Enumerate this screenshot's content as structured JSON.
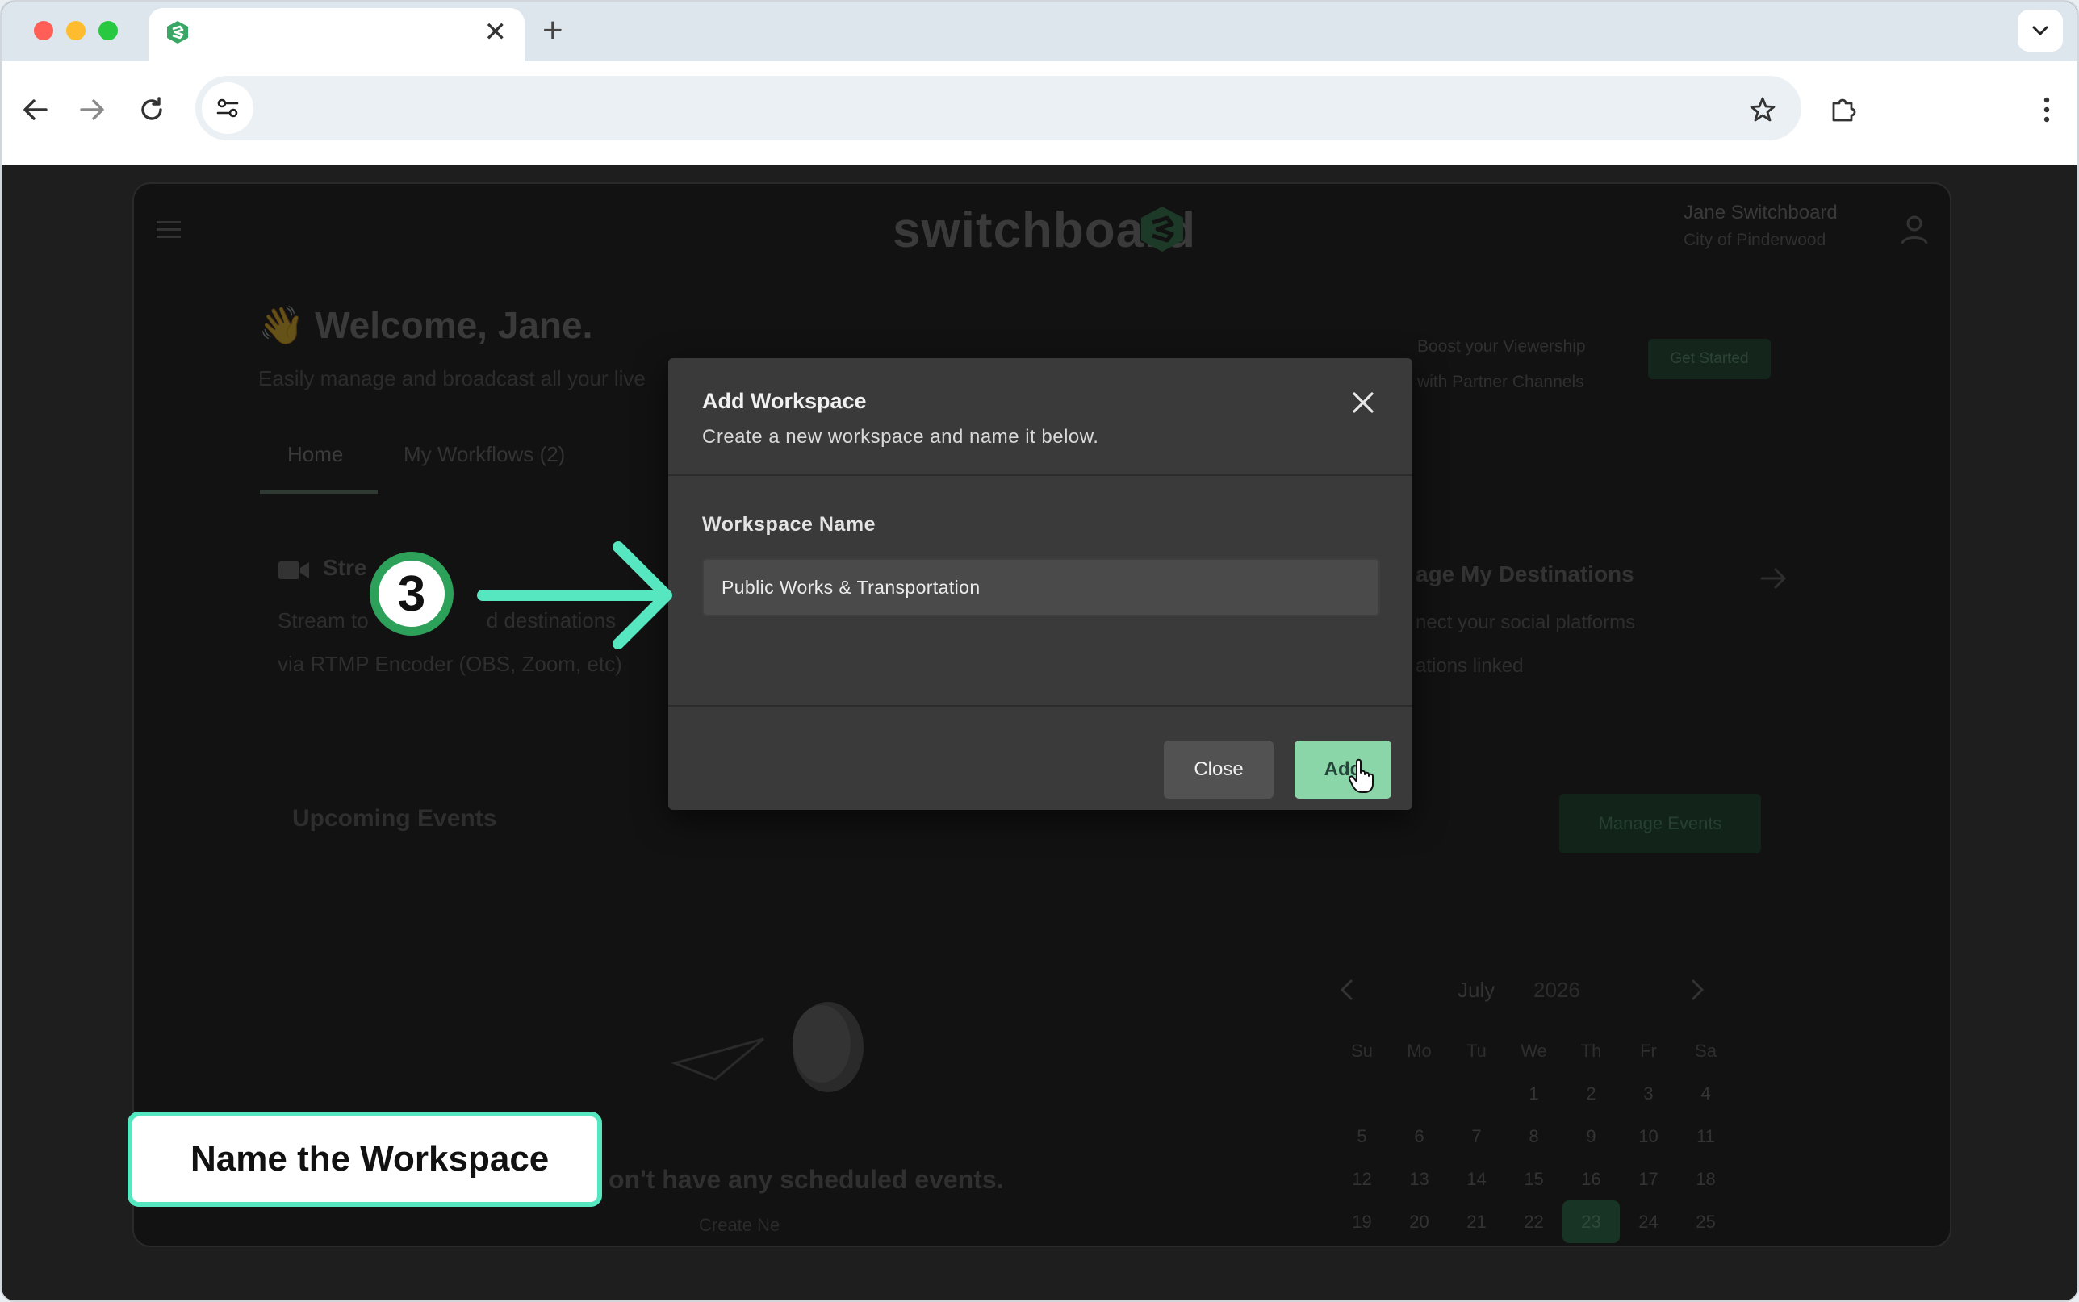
{
  "browser": {
    "tab_close_glyph": "✕",
    "new_tab_glyph": "+"
  },
  "app": {
    "logo_text": "switchboard",
    "user_name": "Jane Switchboard",
    "user_role": "City of Pinderwood",
    "welcome": "Welcome, Jane.",
    "welcome_emoji": "👋",
    "subtitle": "Easily manage and broadcast all your live",
    "tabs": [
      {
        "label": "Home"
      },
      {
        "label": "My Workflows (2)"
      }
    ],
    "boost_line1": "Boost your Viewership",
    "boost_line2": "with Partner Channels",
    "get_started": "Get Started",
    "stream_card": {
      "title": "Stre",
      "line1": "Stream to",
      "line1_tail": "d destinations",
      "line2": "via RTMP Encoder (OBS, Zoom, etc)"
    },
    "destinations_card": {
      "title": "age My Destinations",
      "line1": "nect your social platforms",
      "line2": "ations linked"
    },
    "upcoming_title": "Upcoming Events",
    "manage_events": "Manage Events",
    "empty_message": "on't have any scheduled events.",
    "empty_sub": "Create Ne",
    "calendar": {
      "month": "July",
      "year": "2026",
      "weekdays": [
        "Su",
        "Mo",
        "Tu",
        "We",
        "Th",
        "Fr",
        "Sa"
      ],
      "days": [
        "",
        "",
        "",
        "1",
        "2",
        "3",
        "4",
        "5",
        "6",
        "7",
        "8",
        "9",
        "10",
        "11",
        "12",
        "13",
        "14",
        "15",
        "16",
        "17",
        "18",
        "19",
        "20",
        "21",
        "22",
        "23",
        "24",
        "25"
      ],
      "today": "23"
    }
  },
  "modal": {
    "title": "Add Workspace",
    "description": "Create a new workspace and name it below.",
    "field_label": "Workspace Name",
    "field_value": "Public Works & Transportation",
    "close_button": "Close",
    "add_button": "Add"
  },
  "tutorial": {
    "step_number": "3",
    "callout": "Name the Workspace",
    "accent_color": "#56e6c0",
    "badge_color": "#2da05a"
  },
  "colors": {
    "brand_green": "#8ad6a8",
    "modal_bg": "#3a3a3a",
    "traffic_red": "#ff5f57",
    "traffic_yellow": "#febc2e",
    "traffic_green": "#28c840"
  },
  "icons": {
    "back": "arrow-left-icon",
    "forward": "arrow-right-icon",
    "reload": "reload-icon",
    "site_info": "tune-icon",
    "bookmark": "star-icon",
    "extensions": "puzzle-icon",
    "menu": "kebab-icon",
    "close": "close-icon"
  }
}
